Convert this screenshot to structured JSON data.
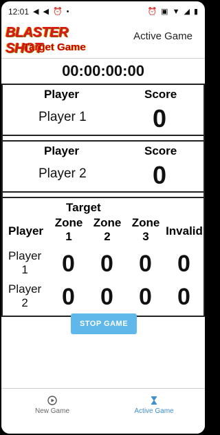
{
  "status_bar": {
    "time": "12:01"
  },
  "header": {
    "logo_title": "BLASTER SHOT",
    "logo_subtitle": "Target Game",
    "title": "Active Game"
  },
  "timer": "00:00:00:00",
  "player_cards": [
    {
      "player_header": "Player",
      "score_header": "Score",
      "name": "Player 1",
      "score": "0"
    },
    {
      "player_header": "Player",
      "score_header": "Score",
      "name": "Player 2",
      "score": "0"
    }
  ],
  "zone_table": {
    "target_label": "Target",
    "player_header": "Player",
    "zone_headers": [
      "Zone\n1",
      "Zone\n2",
      "Zone\n3"
    ],
    "invalid_header": "Invalid",
    "rows": [
      {
        "name": "Player\n1",
        "values": [
          "0",
          "0",
          "0",
          "0"
        ]
      },
      {
        "name": "Player\n2",
        "values": [
          "0",
          "0",
          "0",
          "0"
        ]
      }
    ]
  },
  "stop_button": "STOP GAME",
  "nav": {
    "new_game": "New Game",
    "active_game": "Active Game"
  },
  "colors": {
    "accent": "#5fb7ea",
    "active_nav": "#3d8fd0",
    "logo_red": "#e0141c"
  }
}
